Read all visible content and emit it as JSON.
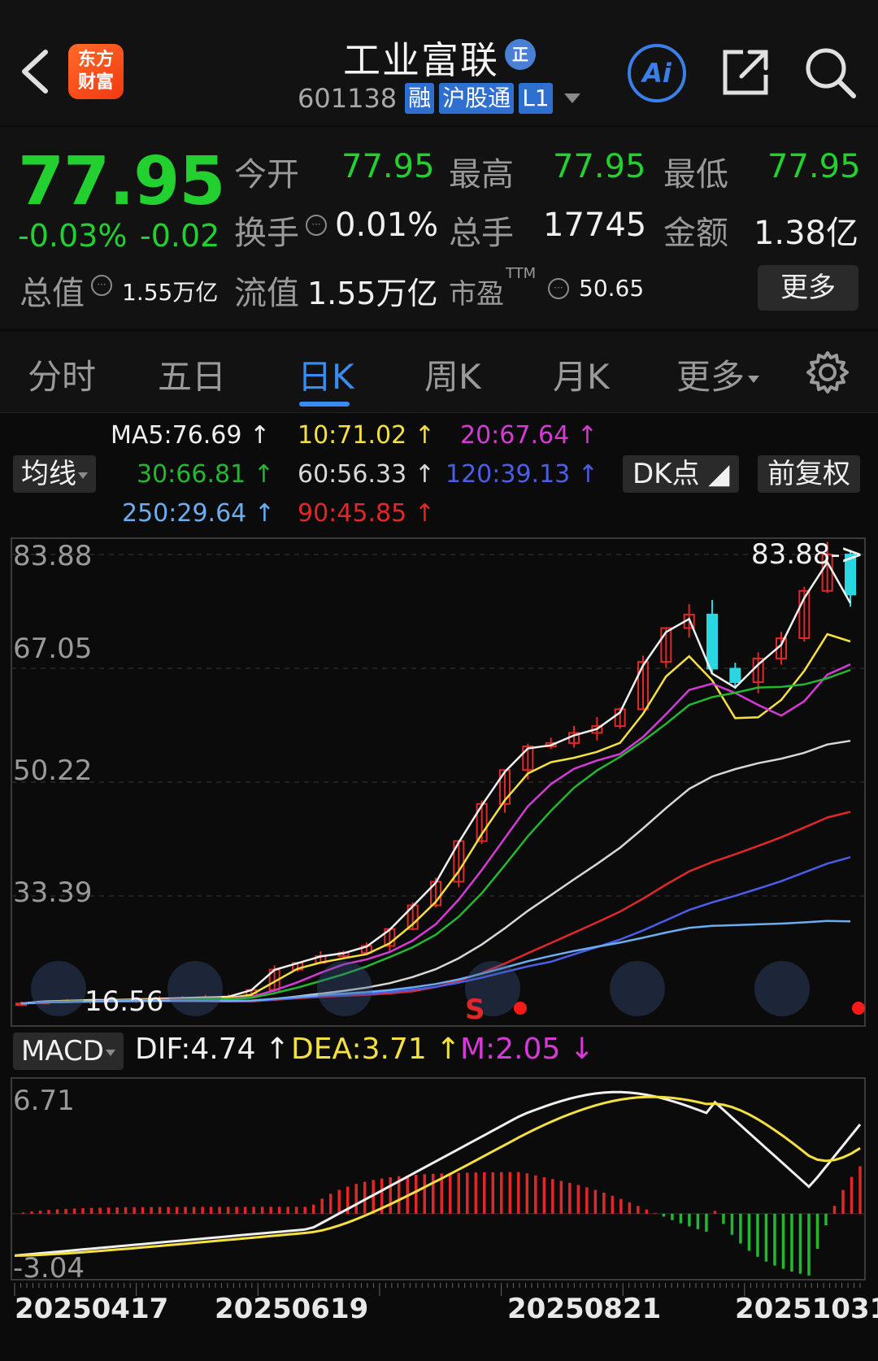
{
  "header": {
    "logo_text": "东方\n财富",
    "stock_name": "工业富联",
    "badge": "正",
    "code": "601138",
    "tags": [
      "融",
      "沪股通",
      "L1"
    ]
  },
  "quote": {
    "price": "77.95",
    "change_pct": "-0.03%",
    "change_abs": "-0.02",
    "open_label": "今开",
    "open": "77.95",
    "high_label": "最高",
    "high": "77.95",
    "low_label": "最低",
    "low": "77.95",
    "turnover_label": "换手",
    "turnover": "0.01%",
    "volume_label": "总手",
    "volume": "17745",
    "amount_label": "金额",
    "amount": "1.38亿",
    "mktcap_label": "总值",
    "mktcap": "1.55万亿",
    "float_label": "流值",
    "float": "1.55万亿",
    "pe_label": "市盈",
    "pe_sup": "TTM",
    "pe": "50.65",
    "more": "更多"
  },
  "tabs": [
    "分时",
    "五日",
    "日K",
    "周K",
    "月K",
    "更多"
  ],
  "active_tab": "日K",
  "ma_legend": {
    "selector": "均线",
    "items": [
      {
        "text": "MA5:76.69",
        "color": "#f0f0f0"
      },
      {
        "text": "10:71.02",
        "color": "#f5e042"
      },
      {
        "text": "20:67.64",
        "color": "#d63ad6"
      },
      {
        "text": "30:66.81",
        "color": "#22b830"
      },
      {
        "text": "60:56.33",
        "color": "#d8d8d8"
      },
      {
        "text": "120:39.13",
        "color": "#4a5ee8"
      },
      {
        "text": "250:29.64",
        "color": "#6aaef0"
      },
      {
        "text": "90:45.85",
        "color": "#e02828"
      }
    ],
    "dk_button": "DK点",
    "adjust_button": "前复权"
  },
  "kline": {
    "y_labels": [
      "83.88",
      "67.05",
      "50.22",
      "33.39"
    ],
    "max_marker": "83.88->",
    "min_marker": "16.56",
    "signal": "S"
  },
  "macd": {
    "selector": "MACD",
    "dif": "DIF:4.74",
    "dea": "DEA:3.71",
    "m": "M:2.05",
    "y_top": "6.71",
    "y_bottom": "-3.04"
  },
  "dates": [
    "20250417",
    "20250619",
    "20250821",
    "20251031"
  ],
  "chart_data": {
    "type": "line",
    "title": "",
    "price_axis_range": [
      16.56,
      83.88
    ],
    "ma_series_latest": [
      {
        "name": "MA5",
        "value": 76.69
      },
      {
        "name": "MA10",
        "value": 71.02
      },
      {
        "name": "MA20",
        "value": 67.64
      },
      {
        "name": "MA30",
        "value": 66.81
      },
      {
        "name": "MA60",
        "value": 56.33
      },
      {
        "name": "MA90",
        "value": 45.85
      },
      {
        "name": "MA120",
        "value": 39.13
      },
      {
        "name": "MA250",
        "value": 29.64
      }
    ],
    "close_trend": [
      17.5,
      17.8,
      17.9,
      18.0,
      18.0,
      18.1,
      18.2,
      18.3,
      18.4,
      18.5,
      19.5,
      22.5,
      23.5,
      24.5,
      25.0,
      26.0,
      28.5,
      32.0,
      35.5,
      41.5,
      47.0,
      52.0,
      55.5,
      56.0,
      57.5,
      58.5,
      61.0,
      68.0,
      73.0,
      75.0,
      67.0,
      65.0,
      68.5,
      71.5,
      78.5,
      83.88,
      77.95
    ],
    "macd_range": [
      -3.04,
      6.71
    ],
    "macd_latest": {
      "DIF": 4.74,
      "DEA": 3.71,
      "M": 2.05
    },
    "x_tick_labels": [
      "20250417",
      "20250619",
      "20250821",
      "20251031"
    ]
  }
}
